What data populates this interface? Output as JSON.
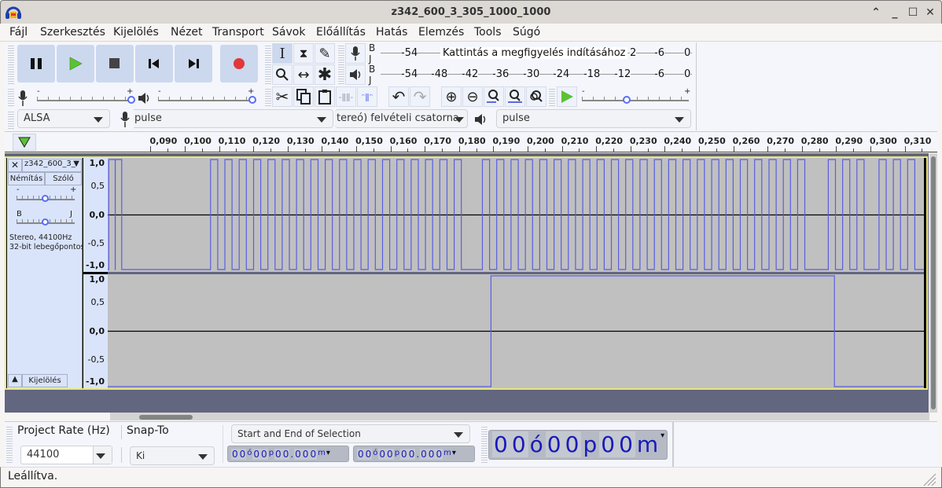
{
  "window": {
    "title": "z342_600_3_305_1000_1000",
    "controls": [
      "^",
      "_",
      "□",
      "✕"
    ]
  },
  "menu": [
    "Fájl",
    "Szerkesztés",
    "Kijelölés",
    "Nézet",
    "Transport",
    "Sávok",
    "Előállítás",
    "Hatás",
    "Elemzés",
    "Tools",
    "Súgó"
  ],
  "transport": {
    "pause": "pause-icon",
    "play": "play-icon",
    "stop": "stop-icon",
    "skip_start": "skip-to-start-icon",
    "skip_end": "skip-to-end-icon",
    "record": "record-icon",
    "colors": {
      "play": "#5bc236",
      "record": "#e0383b",
      "button_bg": "#ccd8ee"
    }
  },
  "tools": {
    "selection": "I",
    "envelope": "⧗",
    "draw": "✎",
    "zoom": "🔍",
    "timeshift": "↔",
    "multi": "✱"
  },
  "meters": {
    "record_label": "B\nJ",
    "record_hint": "Kattintás a megfigyelés indításához",
    "record_scale": [
      "-54",
      "2",
      "-6",
      "0"
    ],
    "play_label": "B\nJ",
    "play_scale": [
      "-54",
      "-48",
      "-42",
      "-36",
      "-30",
      "-24",
      "-18",
      "-12",
      "-6",
      "0"
    ]
  },
  "mixer": {
    "record_volume": 1.0,
    "playback_volume": 1.0,
    "minus": "-",
    "plus": "+"
  },
  "play_at_speed": {
    "minus": "-",
    "plus": "+",
    "speed": 0.42
  },
  "devices": {
    "host": "ALSA",
    "record_device": "pulse",
    "record_channels": "tereó) felvételi csatorna",
    "playback_device": "pulse"
  },
  "ruler": {
    "labels": [
      "0,090",
      "0,100",
      "0,110",
      "0,120",
      "0,130",
      "0,140",
      "0,150",
      "0,160",
      "0,170",
      "0,180",
      "0,190",
      "0,200",
      "0,210",
      "0,220",
      "0,230",
      "0,240",
      "0,250",
      "0,260",
      "0,270",
      "0,280",
      "0,290",
      "0,300",
      "0,310"
    ]
  },
  "track": {
    "name": "z342_600_3_",
    "mute": "Némítás",
    "solo": "Szóló",
    "gain_minus": "-",
    "gain_plus": "+",
    "gain": 0.5,
    "pan_left": "B",
    "pan_right": "J",
    "pan": 0.5,
    "info_line1": "Stereo, 44100Hz",
    "info_line2": "32-bit lebegőpontos",
    "select_button": "Kijelölés",
    "vruler_labels": [
      "1,0",
      "0,5",
      "0,0",
      "-0,5",
      "-1,0"
    ],
    "waveform_color": "#5a5ee0",
    "background_color": "#c0c0c0"
  },
  "waveform": {
    "view_seconds": [
      0.0775,
      0.3156
    ],
    "channel1_gaps_seconds": [
      [
        0.1007,
        0.1075
      ],
      [
        0.1825,
        0.1868
      ],
      [
        0.2835,
        0.2877
      ],
      [
        0.2984,
        0.3025
      ]
    ],
    "channel1_first_pulses_seconds": [
      0.0778,
      0.0797
    ],
    "pulse_period_seconds": 0.00418,
    "channel2_high_seconds": [
      0.1893,
      0.2895
    ]
  },
  "bottom": {
    "project_rate_label": "Project Rate (Hz)",
    "project_rate": "44100",
    "snap_label": "Snap-To",
    "snap_value": "Ki",
    "selection_mode": "Start and End of Selection",
    "sel_start": [
      "0",
      "0",
      "ó",
      "0",
      "0",
      "p",
      "0",
      "0",
      ".",
      "0",
      "0",
      "0",
      "m"
    ],
    "sel_end": [
      "0",
      "0",
      "ó",
      "0",
      "0",
      "p",
      "0",
      "0",
      ".",
      "0",
      "0",
      "0",
      "m"
    ],
    "audio_pos": [
      "0",
      "0",
      "ó",
      "0",
      "0",
      "p",
      "0",
      "0",
      "m"
    ]
  },
  "status": "Leállítva."
}
